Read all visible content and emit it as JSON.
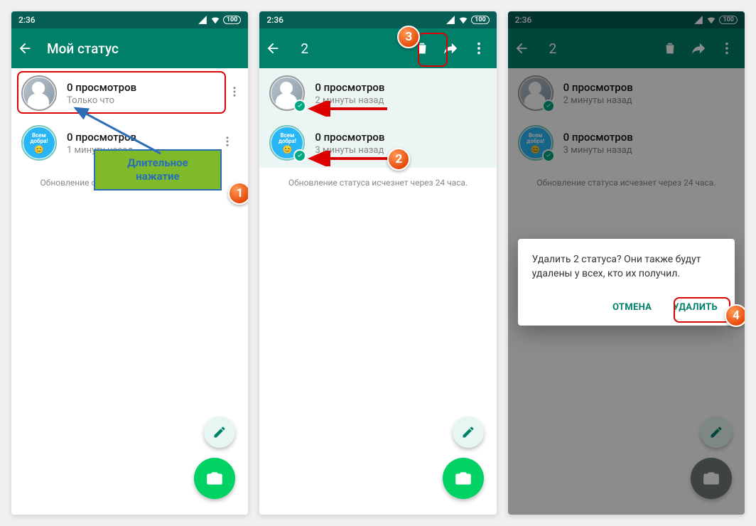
{
  "statusbar": {
    "time": "2:36",
    "battery": "100"
  },
  "screen1": {
    "title": "Мой статус",
    "items": [
      {
        "title": "0 просмотров",
        "sub": "Только что"
      },
      {
        "title": "0 просмотров",
        "sub": "1 минуту назад"
      }
    ],
    "note": "Обновление статуса исчезнет через 24 часа.",
    "callout": "Длительное нажатие",
    "avatar_blue_line1": "Всем",
    "avatar_blue_line2": "добра!"
  },
  "screen2": {
    "selection_count": "2",
    "items": [
      {
        "title": "0 просмотров",
        "sub": "2 минуты назад"
      },
      {
        "title": "0 просмотров",
        "sub": "3 минуты назад"
      }
    ],
    "note": "Обновление статуса исчезнет через 24 часа."
  },
  "screen3": {
    "selection_count": "2",
    "items": [
      {
        "title": "0 просмотров",
        "sub": "2 минуты назад"
      },
      {
        "title": "0 просмотров",
        "sub": "3 минуты назад"
      }
    ],
    "note": "Обновление статуса исчезнет через 24 часа.",
    "dialog": {
      "text": "Удалить 2 статуса? Они также будут удалены у всех, кто их получил.",
      "cancel": "ОТМЕНА",
      "confirm": "УДАЛИТЬ"
    }
  },
  "steps": {
    "s1": "1",
    "s2": "2",
    "s3": "3",
    "s4": "4"
  }
}
